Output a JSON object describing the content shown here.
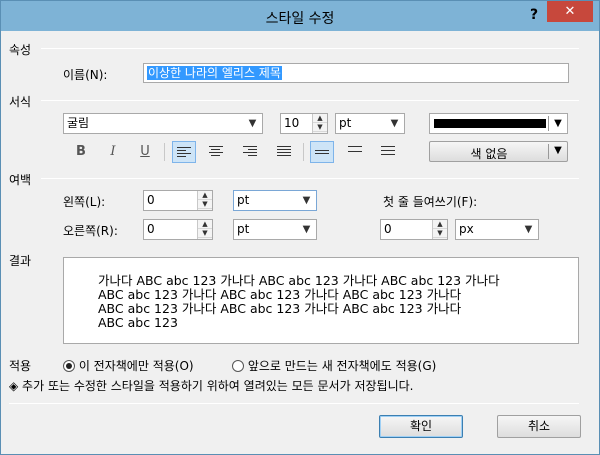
{
  "window": {
    "title": "스타일 수정",
    "help": "?",
    "close": "✕"
  },
  "sections": {
    "attributes": "속성",
    "format": "서식",
    "margins": "여백",
    "result": "결과",
    "apply": "적용"
  },
  "name_field": {
    "label": "이름(N):",
    "value": "이상한 나라의 엘리스 제목"
  },
  "font": {
    "family": "굴림",
    "size": "10",
    "unit": "pt",
    "color_hex": "#000000",
    "background_label": "색 없음"
  },
  "style_buttons": {
    "bold": "B",
    "italic": "I",
    "underline": "U"
  },
  "margins": {
    "left_label": "왼쪽(L):",
    "left_value": "0",
    "left_unit": "pt",
    "right_label": "오른쪽(R):",
    "right_value": "0",
    "right_unit": "pt",
    "indent_label": "첫 줄 들여쓰기(F):",
    "indent_value": "0",
    "indent_unit": "px"
  },
  "result_preview": {
    "lines": [
      "가나다 ABC abc 123 가나다 ABC abc 123 가나다 ABC abc 123 가나다",
      "ABC abc 123 가나다 ABC abc 123 가나다 ABC abc 123 가나다",
      "ABC abc 123 가나다 ABC abc 123 가나다 ABC abc 123 가나다",
      "ABC abc 123"
    ]
  },
  "apply_options": {
    "this_book": "이 전자책에만 적용(O)",
    "new_books": "앞으로 만드는 새 전자책에도 적용(G)"
  },
  "notice": "◈ 추가 또는 수정한 스타일을 적용하기 위하여 열려있는 모든 문서가 저장됩니다.",
  "buttons": {
    "ok": "확인",
    "cancel": "취소"
  }
}
